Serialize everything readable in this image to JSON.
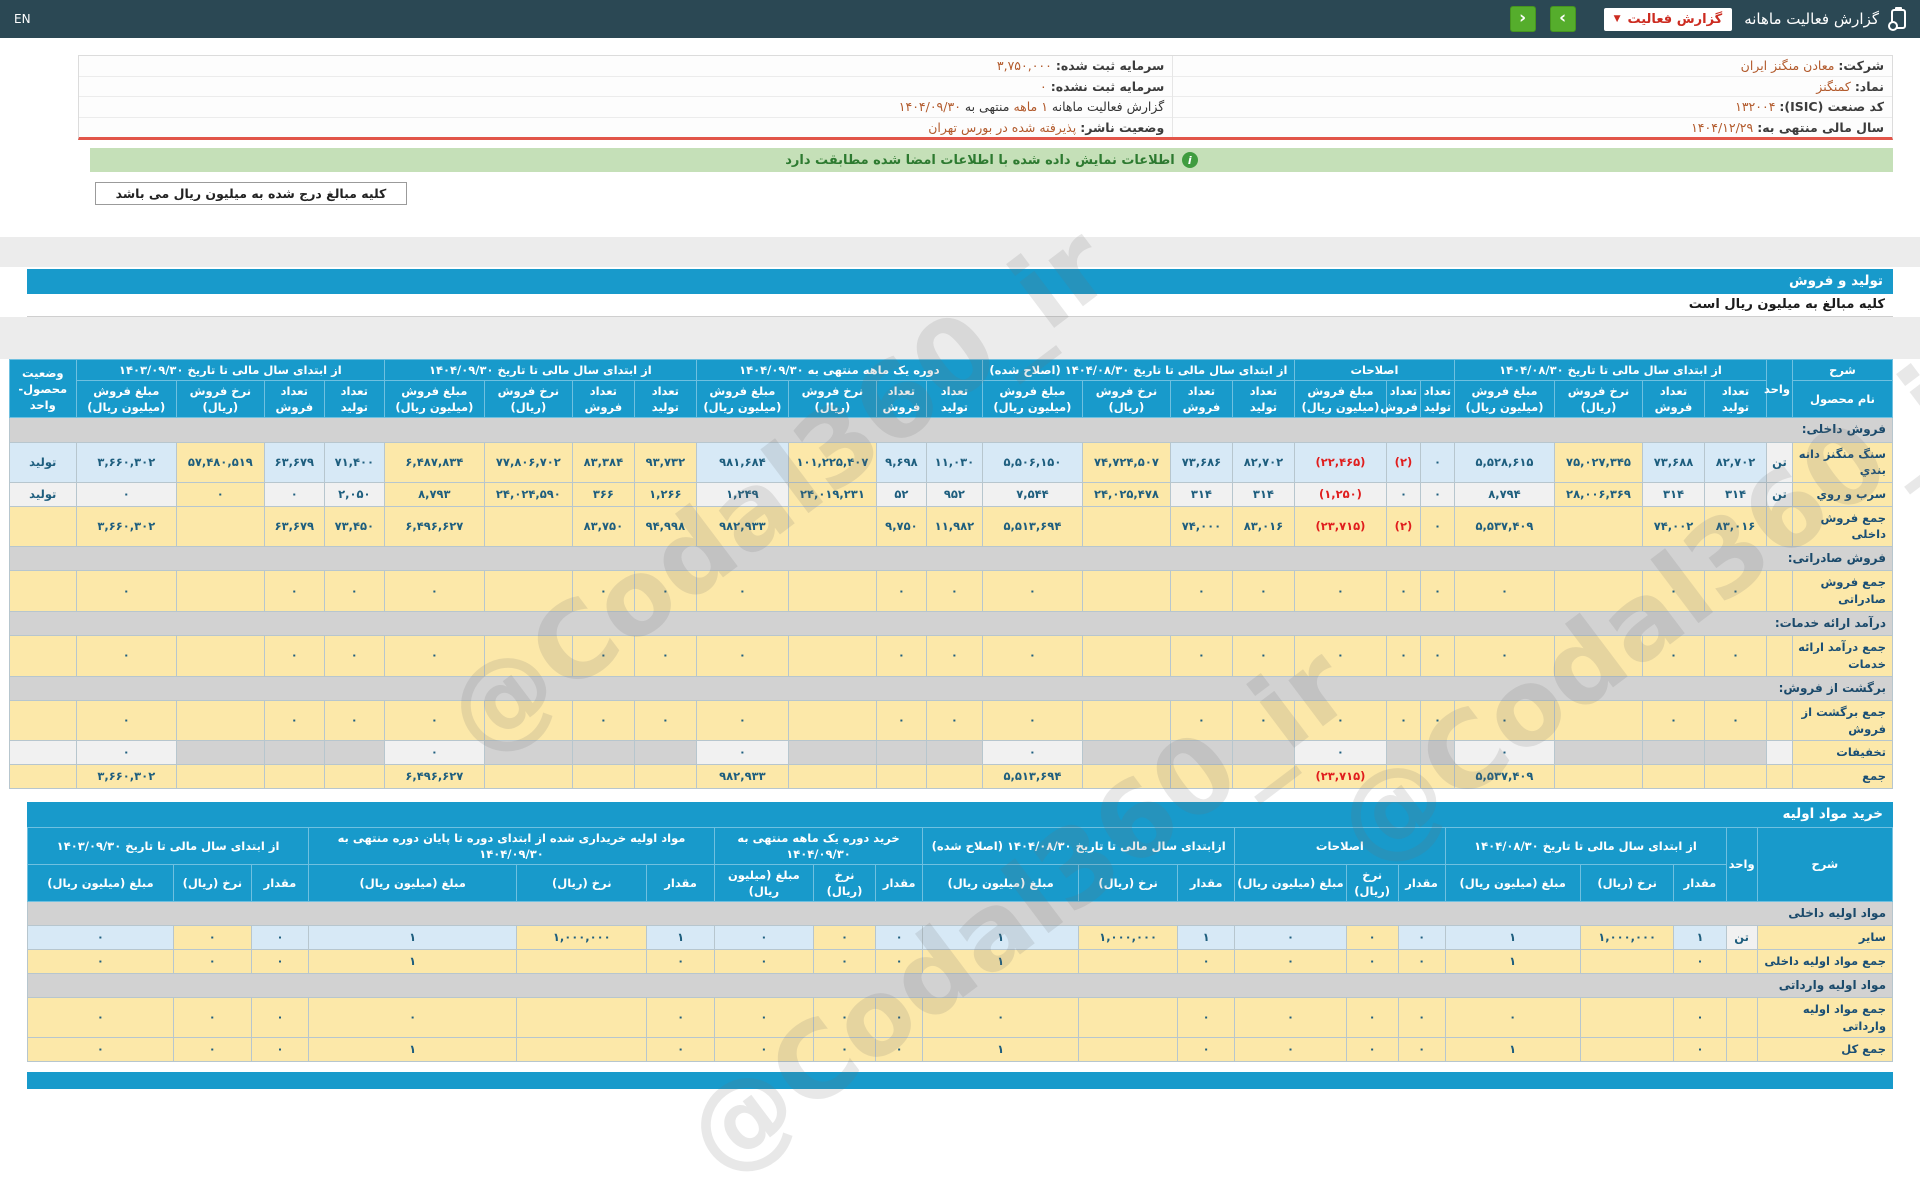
{
  "topbar": {
    "en": "EN",
    "title": "گزارش فعالیت ماهانه",
    "dropdown": "گزارش فعالیت",
    "next": "›",
    "prev": "‹"
  },
  "company_info": {
    "company_col": [
      {
        "label": "شرکت:",
        "value": "معادن منگنز ایران"
      },
      {
        "label": "نماد:",
        "value": "کمنگنز"
      },
      {
        "label": "کد صنعت (ISIC):",
        "value": "۱۳۲۰۰۴"
      },
      {
        "label": "سال مالی منتهی به:",
        "value": "۱۴۰۴/۱۲/۲۹"
      }
    ],
    "capital_col": [
      {
        "label": "سرمایه ثبت شده:",
        "value": "۳,۷۵۰,۰۰۰"
      },
      {
        "label": "سرمایه ثبت نشده:",
        "value": "۰"
      },
      {
        "parts": [
          {
            "t": "گزارش فعالیت ماهانه ",
            "o": false
          },
          {
            "t": "۱ ماهه",
            "o": true
          },
          {
            "t": " منتهی به ",
            "o": false
          },
          {
            "t": "۱۴۰۴/۰۹/۳۰",
            "o": true
          }
        ]
      },
      {
        "label": "وضعیت ناشر:",
        "value": "پذیرفته شده در بورس تهران"
      }
    ]
  },
  "signed_notice": "اطلاعات نمایش داده شده با اطلاعات امضا شده مطابقت دارد",
  "amounts_note": "کلیه مبالغ درج شده به میلیون ریال می باشد",
  "watermark": "@Codal360_ir",
  "colors": {
    "accent_blue": "#189acb",
    "header_dark": "#2b4854",
    "cell_yellow": "#fce8a9",
    "cell_blue": "#d7e9f6",
    "section_gray": "#d2d2d2",
    "negative_red": "#e01e1e",
    "value_orange": "#b25a2c",
    "banner_green": "#c5e0b8",
    "alert_red_line": "#e25549",
    "button_green": "#55ad2c"
  },
  "production_sales": {
    "title": "تولید و فروش",
    "subtitle": "کلیه مبالغ به میلیون ریال است",
    "header": {
      "sherh": "شرح",
      "name": "نام محصول",
      "unit": "واحد",
      "status": "وضعیت محصول-واحد",
      "groups": [
        {
          "label": "از ابتدای سال مالی تا تاریخ ۱۴۰۴/۰۸/۳۰",
          "cols": 4
        },
        {
          "label": "اصلاحات",
          "cols": 3
        },
        {
          "label": "از ابتدای سال مالی تا تاریخ ۱۴۰۴/۰۸/۳۰ (اصلاح شده)",
          "cols": 4
        },
        {
          "label": "دوره یک ماهه منتهی به ۱۴۰۴/۰۹/۳۰",
          "cols": 4
        },
        {
          "label": "از ابتدای سال مالی تا تاریخ ۱۴۰۴/۰۹/۳۰",
          "cols": 4
        },
        {
          "label": "از ابتدای سال مالی تا تاریخ ۱۴۰۳/۰۹/۳۰",
          "cols": 4
        }
      ],
      "sub4": [
        "تعداد تولید",
        "تعداد فروش",
        "نرخ فروش (ریال)",
        "مبلغ فروش (میلیون ریال)"
      ],
      "sub3": [
        "تعداد تولید",
        "تعداد فروش",
        "مبلغ فروش (میلیون ریال)"
      ]
    },
    "rows": [
      {
        "type": "section",
        "label": "فروش داخلی:"
      },
      {
        "type": "data",
        "style": "blue",
        "label": "سنگ منگنز دانه بندي",
        "unit": "تن",
        "status": "تولید",
        "cells": [
          "۸۲,۷۰۲",
          "۷۳,۶۸۸",
          "۷۵,۰۲۷,۳۴۵",
          "۵,۵۲۸,۶۱۵",
          "۰",
          "(۲)",
          "(۲۲,۴۶۵)",
          "۸۲,۷۰۲",
          "۷۳,۶۸۶",
          "۷۴,۷۲۴,۵۰۷",
          "۵,۵۰۶,۱۵۰",
          "۱۱,۰۳۰",
          "۹,۶۹۸",
          "۱۰۱,۲۲۵,۴۰۷",
          "۹۸۱,۶۸۴",
          "۹۳,۷۳۲",
          "۸۳,۳۸۴",
          "۷۷,۸۰۶,۷۰۲",
          "۶,۴۸۷,۸۳۴",
          "۷۱,۴۰۰",
          "۶۳,۶۷۹",
          "۵۷,۴۸۰,۵۱۹",
          "۳,۶۶۰,۳۰۲"
        ]
      },
      {
        "type": "data",
        "style": "white",
        "label": "سرب و روي",
        "unit": "تن",
        "status": "تولید",
        "cells": [
          "۳۱۴",
          "۳۱۴",
          "۲۸,۰۰۶,۳۶۹",
          "۸,۷۹۴",
          "۰",
          "۰",
          "(۱,۲۵۰)",
          "۳۱۴",
          "۳۱۴",
          "۲۴,۰۲۵,۴۷۸",
          "۷,۵۴۴",
          "۹۵۲",
          "۵۲",
          "۲۴,۰۱۹,۲۳۱",
          "۱,۲۴۹",
          "۱,۲۶۶",
          "۳۶۶",
          "۲۴,۰۲۴,۵۹۰",
          "۸,۷۹۳",
          "۲,۰۵۰",
          "۰",
          "۰",
          "۰"
        ]
      },
      {
        "type": "sum",
        "label": "جمع فروش داخلی",
        "cells": [
          "۸۳,۰۱۶",
          "۷۴,۰۰۲",
          "",
          "۵,۵۳۷,۴۰۹",
          "۰",
          "(۲)",
          "(۲۳,۷۱۵)",
          "۸۳,۰۱۶",
          "۷۴,۰۰۰",
          "",
          "۵,۵۱۳,۶۹۴",
          "۱۱,۹۸۲",
          "۹,۷۵۰",
          "",
          "۹۸۲,۹۳۳",
          "۹۴,۹۹۸",
          "۸۳,۷۵۰",
          "",
          "۶,۴۹۶,۶۲۷",
          "۷۳,۴۵۰",
          "۶۳,۶۷۹",
          "",
          "۳,۶۶۰,۳۰۲"
        ]
      },
      {
        "type": "section",
        "label": "فروش صادراتی:"
      },
      {
        "type": "sum",
        "label": "جمع فروش صادراتی",
        "cells": [
          "۰",
          "۰",
          "",
          "۰",
          "۰",
          "۰",
          "۰",
          "۰",
          "۰",
          "",
          "۰",
          "۰",
          "۰",
          "",
          "۰",
          "۰",
          "۰",
          "",
          "۰",
          "۰",
          "۰",
          "",
          "۰"
        ]
      },
      {
        "type": "section",
        "label": "درآمد ارائه خدمات:"
      },
      {
        "type": "sum",
        "label": "جمع درآمد ارائه خدمات",
        "cells": [
          "۰",
          "۰",
          "",
          "۰",
          "۰",
          "۰",
          "۰",
          "۰",
          "۰",
          "",
          "۰",
          "۰",
          "۰",
          "",
          "۰",
          "۰",
          "۰",
          "",
          "۰",
          "۰",
          "۰",
          "",
          "۰"
        ]
      },
      {
        "type": "section",
        "label": "برگشت از فروش:"
      },
      {
        "type": "sum",
        "label": "جمع برگشت از فروش",
        "cells": [
          "۰",
          "۰",
          "",
          "۰",
          "۰",
          "۰",
          "۰",
          "۰",
          "۰",
          "",
          "۰",
          "۰",
          "۰",
          "",
          "۰",
          "۰",
          "۰",
          "",
          "۰",
          "۰",
          "۰",
          "",
          "۰"
        ]
      },
      {
        "type": "disc",
        "label": "تخفیفات",
        "cells": [
          "",
          "",
          "",
          "۰",
          "",
          "",
          "۰",
          "",
          "",
          "",
          "۰",
          "",
          "",
          "",
          "۰",
          "",
          "",
          "",
          "۰",
          "",
          "",
          "",
          "۰"
        ]
      },
      {
        "type": "sum",
        "label": "جمع",
        "cells": [
          "",
          "",
          "",
          "۵,۵۳۷,۴۰۹",
          "",
          "",
          "(۲۳,۷۱۵)",
          "",
          "",
          "",
          "۵,۵۱۳,۶۹۴",
          "",
          "",
          "",
          "۹۸۲,۹۳۳",
          "",
          "",
          "",
          "۶,۴۹۶,۶۲۷",
          "",
          "",
          "",
          "۳,۶۶۰,۳۰۲"
        ]
      }
    ]
  },
  "raw_materials": {
    "title": "خرید مواد اولیه",
    "header": {
      "sherh": "شرح",
      "unit": "واحد",
      "groups": [
        {
          "label": "از ابتدای سال مالی تا تاریخ ۱۴۰۴/۰۸/۳۰"
        },
        {
          "label": "اصلاحات"
        },
        {
          "label": "ازابتدای سال مالی تا تاریخ ۱۴۰۴/۰۸/۳۰ (اصلاح شده)"
        },
        {
          "label": "خرید دوره یک ماهه منتهی به ۱۴۰۴/۰۹/۳۰"
        },
        {
          "label": "مواد اولیه خریداری شده از ابتدای دوره تا پایان دوره منتهی به ۱۴۰۴/۰۹/۳۰"
        },
        {
          "label": "از ابتدای سال مالی تا تاریخ ۱۴۰۳/۰۹/۳۰"
        }
      ],
      "sub": [
        "مقدار",
        "نرخ (ریال)",
        "مبلغ (میلیون ریال)"
      ]
    },
    "rows": [
      {
        "type": "section",
        "label": "مواد اولیه داخلی"
      },
      {
        "type": "data",
        "style": "blue",
        "label": "سایر",
        "unit": "تن",
        "cells": [
          "۱",
          "۱,۰۰۰,۰۰۰",
          "۱",
          "۰",
          "۰",
          "۰",
          "۱",
          "۱,۰۰۰,۰۰۰",
          "۱",
          "۰",
          "۰",
          "۰",
          "۱",
          "۱,۰۰۰,۰۰۰",
          "۱",
          "۰",
          "۰",
          "۰"
        ]
      },
      {
        "type": "sum",
        "label": "جمع مواد اولیه داخلی",
        "cells": [
          "۰",
          "",
          "۱",
          "۰",
          "۰",
          "۰",
          "۰",
          "",
          "۱",
          "۰",
          "۰",
          "۰",
          "۰",
          "",
          "۱",
          "۰",
          "۰",
          "۰"
        ]
      },
      {
        "type": "section",
        "label": "مواد اولیه وارداتی"
      },
      {
        "type": "sum",
        "label": "جمع مواد اولیه وارداتی",
        "cells": [
          "۰",
          "",
          "۰",
          "۰",
          "۰",
          "۰",
          "۰",
          "",
          "۰",
          "۰",
          "۰",
          "۰",
          "۰",
          "",
          "۰",
          "۰",
          "۰",
          "۰"
        ]
      },
      {
        "type": "sum",
        "label": "جمع کل",
        "cells": [
          "۰",
          "",
          "۱",
          "۰",
          "۰",
          "۰",
          "۰",
          "",
          "۱",
          "۰",
          "۰",
          "۰",
          "۰",
          "",
          "۱",
          "۰",
          "۰",
          "۰"
        ]
      }
    ]
  }
}
